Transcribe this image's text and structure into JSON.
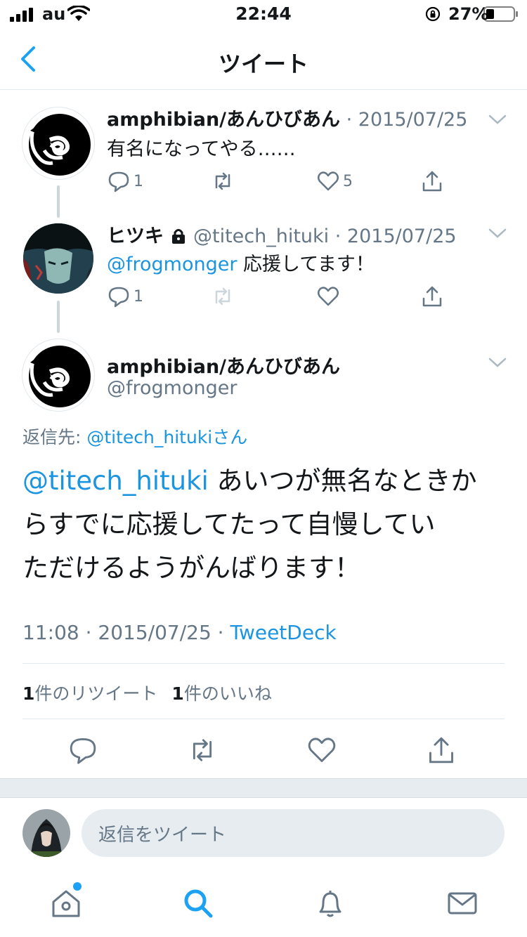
{
  "status_bar": {
    "carrier": "au",
    "time": "22:44",
    "battery": "27%"
  },
  "nav": {
    "title": "ツイート"
  },
  "thread": [
    {
      "name": "amphibian/あんひびあん",
      "meta": " · 2015/07/25",
      "text": "有名になってやる……",
      "reply_count": "1",
      "retweet_count": "",
      "like_count": "5"
    },
    {
      "name": "ヒツキ",
      "meta": " @titech_hituki · 2015/07/25",
      "mention": "@frogmonger",
      "text": " 応援してます！",
      "reply_count": "1",
      "retweet_count": "",
      "like_count": ""
    }
  ],
  "main_tweet": {
    "name": "amphibian/あんひびあん",
    "handle": "@frogmonger",
    "reply_to_label": "返信先: ",
    "reply_to_user": "@titech_hitukiさん",
    "mention": "@titech_hituki",
    "line1": " あいつが無名なときか",
    "line2": "らすでに応援してたって自慢してい",
    "line3": "ただけるようがんばります！",
    "time": "11:08 · 2015/07/25 · ",
    "source": "TweetDeck",
    "retweet_count": "1",
    "retweet_label": "件のリツイート",
    "like_count": "1",
    "like_label": "件のいいね"
  },
  "composer": {
    "placeholder": "返信をツイート"
  },
  "colors": {
    "link": "#1b95e0",
    "accent": "#1da1f2",
    "muted": "#657786"
  },
  "icons": [
    "back-chevron-icon",
    "reply-icon",
    "retweet-icon",
    "like-icon",
    "share-icon",
    "lock-icon",
    "home-icon",
    "search-icon",
    "notifications-icon",
    "messages-icon"
  ]
}
